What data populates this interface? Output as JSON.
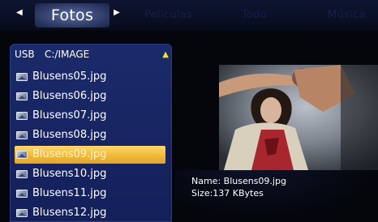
{
  "tabs": [
    {
      "label": "Fotos",
      "active": true
    },
    {
      "label": "Películas",
      "active": false
    },
    {
      "label": "Todo",
      "active": false
    },
    {
      "label": "Música",
      "active": false
    }
  ],
  "nav": {
    "left_arrow": "◀",
    "right_arrow": "▶"
  },
  "browser": {
    "device": "USB",
    "path": "C:/IMAGE",
    "up_icon": "▲",
    "files": [
      {
        "name": "Blusens05.jpg"
      },
      {
        "name": "Blusens06.jpg"
      },
      {
        "name": "Blusens07.jpg"
      },
      {
        "name": "Blusens08.jpg"
      },
      {
        "name": "Blusens09.jpg",
        "selected": true
      },
      {
        "name": "Blusens10.jpg"
      },
      {
        "name": "Blusens11.jpg"
      },
      {
        "name": "Blusens12.jpg"
      }
    ]
  },
  "details": {
    "name": "Name: Blusens09.jpg",
    "size": "Size:137 KBytes"
  },
  "colors": {
    "selection": "#f0b93a",
    "panel": "#1b2a6a",
    "background": "#04060c"
  }
}
